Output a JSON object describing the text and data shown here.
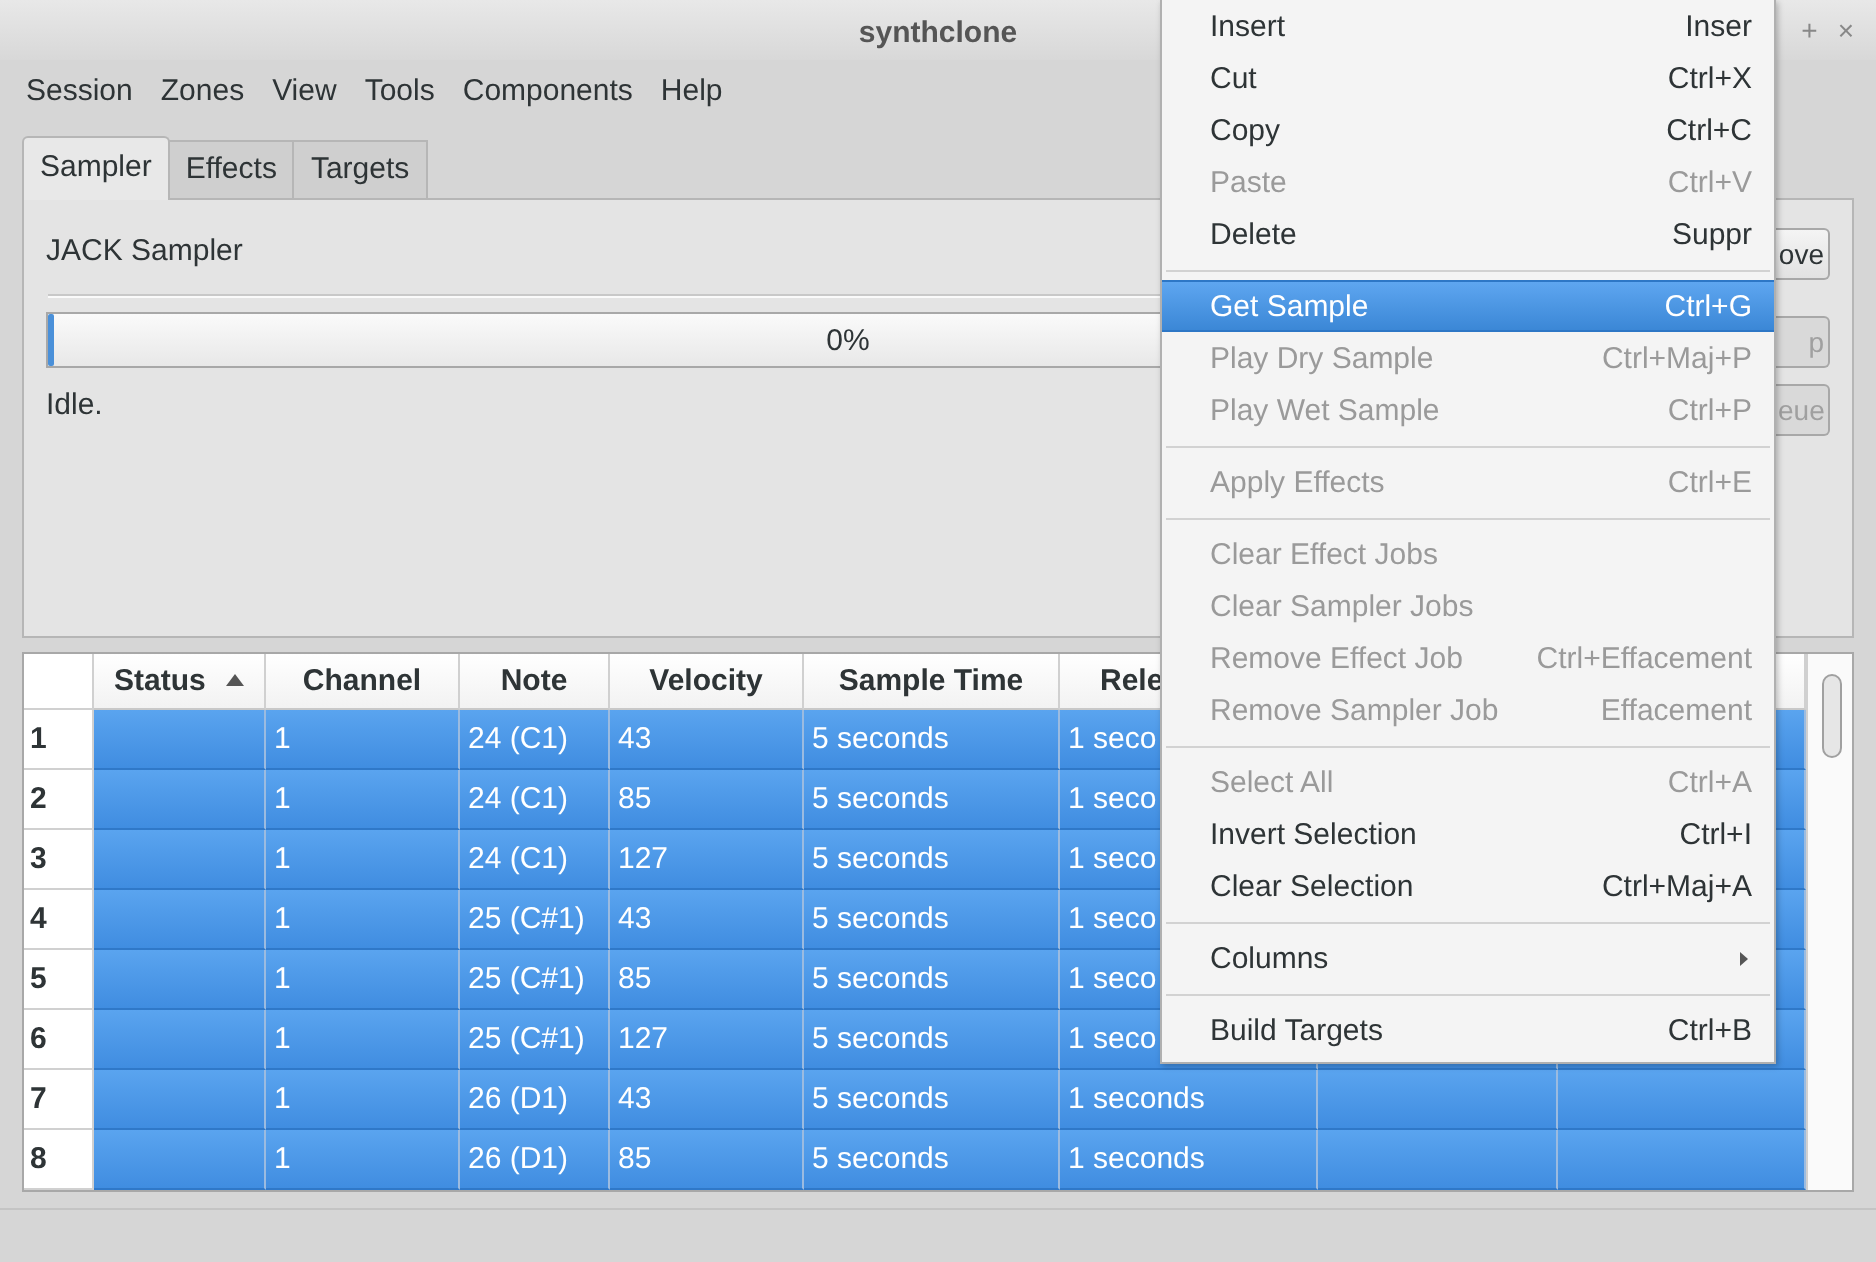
{
  "window": {
    "title": "synthclone",
    "controls": [
      "+",
      "×"
    ]
  },
  "menubar": [
    "Session",
    "Zones",
    "View",
    "Tools",
    "Components",
    "Help"
  ],
  "tabs": [
    {
      "label": "Sampler",
      "selected": true
    },
    {
      "label": "Effects",
      "selected": false
    },
    {
      "label": "Targets",
      "selected": false
    }
  ],
  "sampler_panel": {
    "title": "JACK Sampler",
    "progress": {
      "level": 0,
      "text": "0%"
    },
    "status": "Idle.",
    "buttons": [
      {
        "label": "ove",
        "disabled": false
      },
      {
        "label": "p",
        "disabled": true
      },
      {
        "label": "eue",
        "disabled": true
      }
    ]
  },
  "table": {
    "columns": [
      {
        "label": "Status",
        "sorted": true
      },
      {
        "label": "Channel",
        "sorted": false
      },
      {
        "label": "Note",
        "sorted": false
      },
      {
        "label": "Velocity",
        "sorted": false
      },
      {
        "label": "Sample Time",
        "sorted": false
      },
      {
        "label": "Rele",
        "sorted": false
      }
    ],
    "rows": [
      {
        "header": "1",
        "selected": true,
        "cells": [
          "",
          "1",
          "24 (C1)",
          "43",
          "5 seconds",
          "1 seco"
        ]
      },
      {
        "header": "2",
        "selected": true,
        "cells": [
          "",
          "1",
          "24 (C1)",
          "85",
          "5 seconds",
          "1 seco"
        ]
      },
      {
        "header": "3",
        "selected": true,
        "cells": [
          "",
          "1",
          "24 (C1)",
          "127",
          "5 seconds",
          "1 seco"
        ]
      },
      {
        "header": "4",
        "selected": true,
        "cells": [
          "",
          "1",
          "25 (C#1)",
          "43",
          "5 seconds",
          "1 seco"
        ]
      },
      {
        "header": "5",
        "selected": true,
        "cells": [
          "",
          "1",
          "25 (C#1)",
          "85",
          "5 seconds",
          "1 seco"
        ]
      },
      {
        "header": "6",
        "selected": true,
        "cells": [
          "",
          "1",
          "25 (C#1)",
          "127",
          "5 seconds",
          "1 seco"
        ]
      },
      {
        "header": "7",
        "selected": true,
        "cells": [
          "",
          "1",
          "26 (D1)",
          "43",
          "5 seconds",
          "1 seconds"
        ]
      },
      {
        "header": "8",
        "selected": true,
        "cells": [
          "",
          "1",
          "26 (D1)",
          "85",
          "5 seconds",
          "1 seconds"
        ]
      }
    ]
  },
  "context_menu": [
    {
      "kind": "item",
      "label": "Insert",
      "shortcut": "Inser",
      "disabled": false,
      "selected": false
    },
    {
      "kind": "item",
      "label": "Cut",
      "shortcut": "Ctrl+X",
      "disabled": false,
      "selected": false
    },
    {
      "kind": "item",
      "label": "Copy",
      "shortcut": "Ctrl+C",
      "disabled": false,
      "selected": false
    },
    {
      "kind": "item",
      "label": "Paste",
      "shortcut": "Ctrl+V",
      "disabled": true,
      "selected": false
    },
    {
      "kind": "item",
      "label": "Delete",
      "shortcut": "Suppr",
      "disabled": false,
      "selected": false
    },
    {
      "kind": "separator"
    },
    {
      "kind": "item",
      "label": "Get Sample",
      "shortcut": "Ctrl+G",
      "disabled": false,
      "selected": true
    },
    {
      "kind": "item",
      "label": "Play Dry Sample",
      "shortcut": "Ctrl+Maj+P",
      "disabled": true,
      "selected": false
    },
    {
      "kind": "item",
      "label": "Play Wet Sample",
      "shortcut": "Ctrl+P",
      "disabled": true,
      "selected": false
    },
    {
      "kind": "separator"
    },
    {
      "kind": "item",
      "label": "Apply Effects",
      "shortcut": "Ctrl+E",
      "disabled": true,
      "selected": false
    },
    {
      "kind": "separator"
    },
    {
      "kind": "item",
      "label": "Clear Effect Jobs",
      "disabled": true,
      "selected": false
    },
    {
      "kind": "item",
      "label": "Clear Sampler Jobs",
      "disabled": true,
      "selected": false
    },
    {
      "kind": "item",
      "label": "Remove Effect Job",
      "shortcut": "Ctrl+Effacement",
      "disabled": true,
      "selected": false
    },
    {
      "kind": "item",
      "label": "Remove Sampler Job",
      "shortcut": "Effacement",
      "disabled": true,
      "selected": false
    },
    {
      "kind": "separator"
    },
    {
      "kind": "item",
      "label": "Select All",
      "shortcut": "Ctrl+A",
      "disabled": true,
      "selected": false
    },
    {
      "kind": "item",
      "label": "Invert Selection",
      "shortcut": "Ctrl+I",
      "disabled": false,
      "selected": false
    },
    {
      "kind": "item",
      "label": "Clear Selection",
      "shortcut": "Ctrl+Maj+A",
      "disabled": false,
      "selected": false
    },
    {
      "kind": "separator"
    },
    {
      "kind": "submenu",
      "label": "Columns",
      "disabled": false,
      "selected": false
    },
    {
      "kind": "separator"
    },
    {
      "kind": "item",
      "label": "Build Targets",
      "shortcut": "Ctrl+B",
      "disabled": false,
      "selected": false
    }
  ]
}
